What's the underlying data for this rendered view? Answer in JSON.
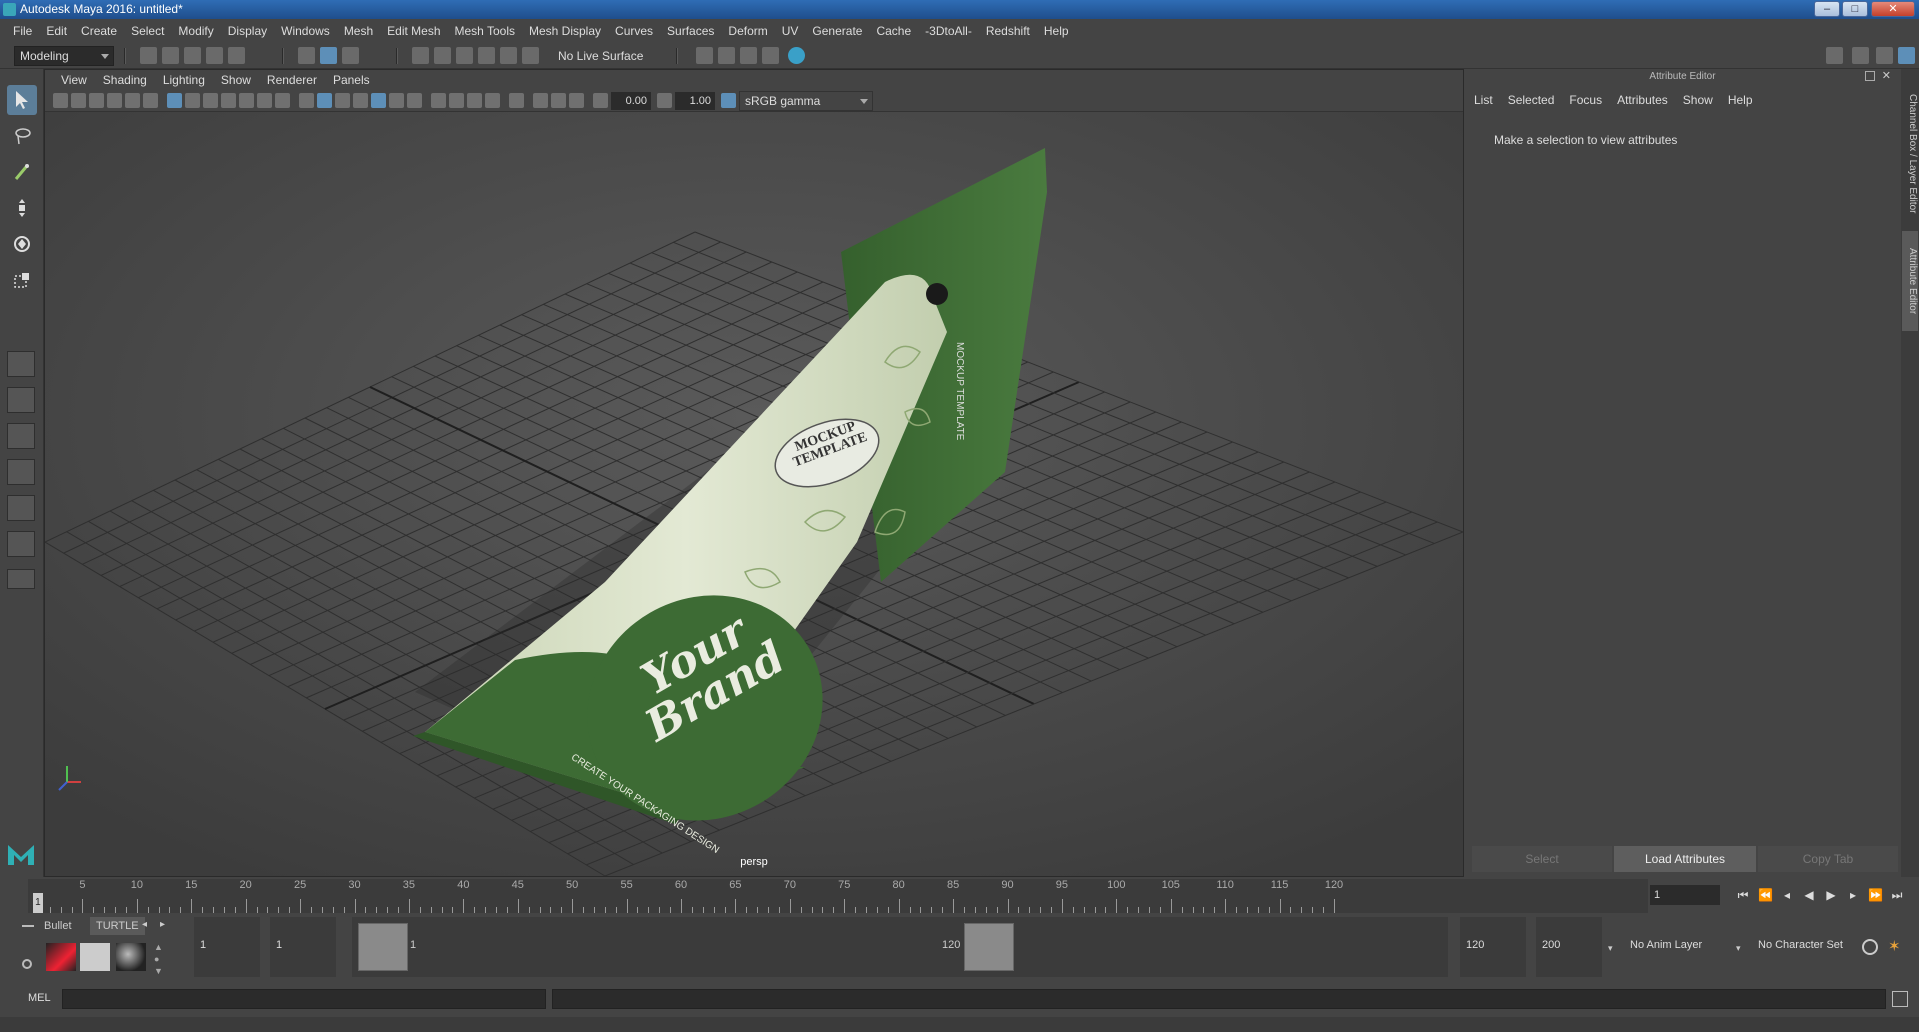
{
  "window": {
    "title": "Autodesk Maya 2016: untitled*",
    "min": "–",
    "max": "□",
    "close": "✕"
  },
  "menubar": [
    "File",
    "Edit",
    "Create",
    "Select",
    "Modify",
    "Display",
    "Windows",
    "Mesh",
    "Edit Mesh",
    "Mesh Tools",
    "Mesh Display",
    "Curves",
    "Surfaces",
    "Deform",
    "UV",
    "Generate",
    "Cache",
    "-3DtoAll-",
    "Redshift",
    "Help"
  ],
  "toolbar": {
    "mode": "Modeling",
    "live_surface": "No Live Surface"
  },
  "viewport": {
    "menu": [
      "View",
      "Shading",
      "Lighting",
      "Show",
      "Renderer",
      "Panels"
    ],
    "exposure": "0.00",
    "gamma": "1.00",
    "colorspace": "sRGB gamma",
    "camera_label": "persp",
    "product": {
      "badge_line1": "MOCKUP",
      "badge_line2": "TEMPLATE",
      "brand_line1": "Your",
      "brand_line2": "Brand",
      "tagline": "CREATE YOUR PACKAGING DESIGN",
      "side_text": "MOCKUP TEMPLATE",
      "colors": {
        "green": "#3d6b34",
        "cream": "#d9e2c9"
      }
    }
  },
  "attribute_editor": {
    "title": "Attribute Editor",
    "menu": [
      "List",
      "Selected",
      "Focus",
      "Attributes",
      "Show",
      "Help"
    ],
    "message": "Make a selection to view attributes",
    "buttons": {
      "select": "Select",
      "load": "Load Attributes",
      "copy": "Copy Tab"
    }
  },
  "side_tabs": {
    "channel_box": "Channel Box / Layer Editor",
    "attribute_editor": "Attribute Editor"
  },
  "timeline": {
    "ticks": [
      5,
      10,
      15,
      20,
      25,
      30,
      35,
      40,
      45,
      50,
      55,
      60,
      65,
      70,
      75,
      80,
      85,
      90,
      95,
      100,
      105,
      110,
      115,
      120
    ],
    "current_marker": "1",
    "current_frame": "1"
  },
  "shelf": {
    "tabs": [
      "Bullet",
      "TURTLE"
    ]
  },
  "range": {
    "start": "1",
    "playback_start": "1",
    "slider_start": "1",
    "slider_end": "120",
    "playback_end": "120",
    "end": "200",
    "anim_layer": "No Anim Layer",
    "char_set": "No Character Set"
  },
  "cmdline": {
    "label": "MEL"
  }
}
